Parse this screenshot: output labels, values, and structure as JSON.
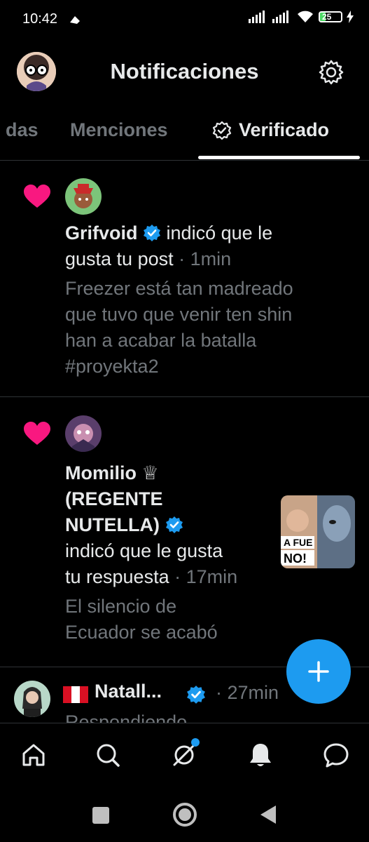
{
  "status_bar": {
    "time": "10:42",
    "battery": "25"
  },
  "header": {
    "title": "Notificaciones"
  },
  "tabs": [
    {
      "label": "das"
    },
    {
      "label": "Menciones"
    },
    {
      "label": "Verificado"
    }
  ],
  "notifications": [
    {
      "user": "Grifvoid",
      "action_line1": "indicó que le",
      "action_line2": "gusta tu post",
      "time": "· 1min",
      "snippet": [
        "Freezer está tan madreado",
        "que tuvo que venir ten shin",
        "han a acabar la batalla",
        "#proyekta2"
      ]
    },
    {
      "user_line1": "Momilio ♕",
      "user_line2": "(REGENTE",
      "user_line3": "NUTELLA)",
      "action_line1": "indicó que le gusta",
      "action_line2": "tu respuesta",
      "time": "· 17min",
      "snippet": [
        "El silencio de",
        "Ecuador se acabó"
      ],
      "thumb_text_1": "A FUE",
      "thumb_text_2": "NO!"
    },
    {
      "user": "Natall...",
      "time": "· 27min",
      "reply": "Respondiendo"
    }
  ],
  "colors": {
    "accent": "#1d9bf0",
    "like": "#f91880",
    "muted": "#71767b"
  },
  "icons": [
    "home-icon",
    "search-icon",
    "grok-icon",
    "bell-icon",
    "messages-icon"
  ]
}
